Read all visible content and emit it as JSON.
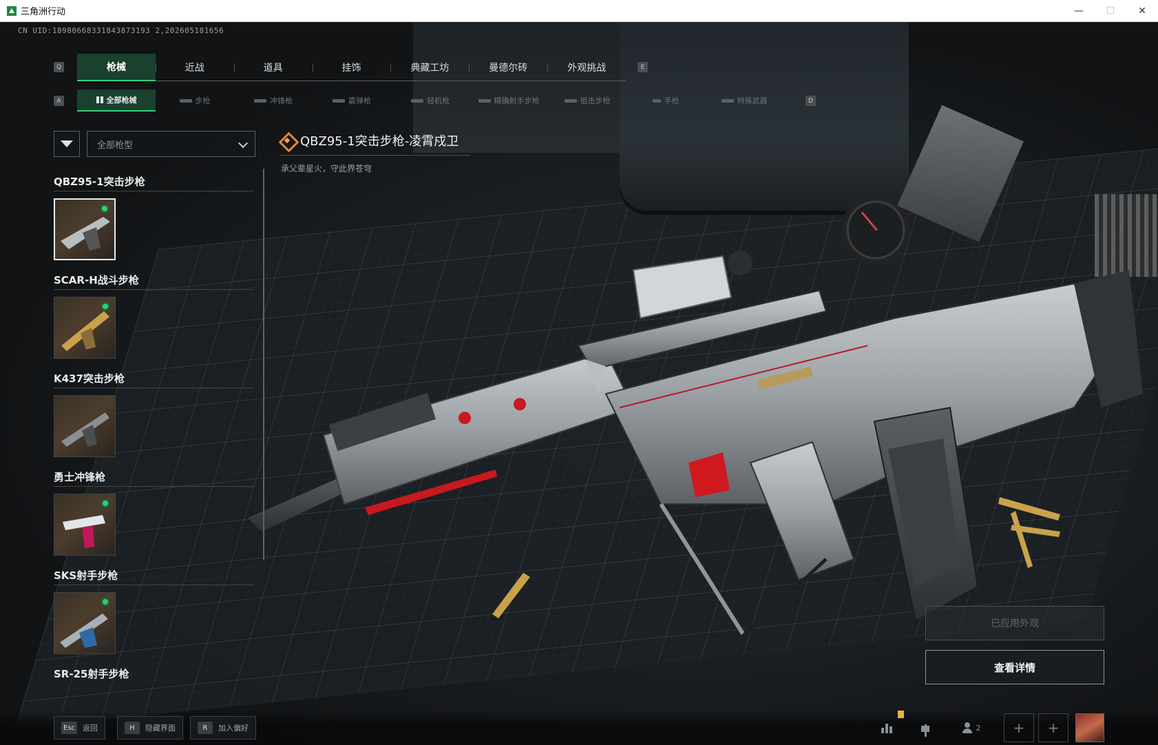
{
  "window": {
    "title": "三角洲行动",
    "minimize": "—",
    "maximize": "☐",
    "close": "✕"
  },
  "uid_line": "CN UID:18980668331843873193 2,202605181656",
  "tabs": {
    "left_key": "Q",
    "right_key": "E",
    "items": [
      {
        "label": "枪械",
        "active": true
      },
      {
        "label": "近战"
      },
      {
        "label": "道具"
      },
      {
        "label": "挂饰"
      },
      {
        "label": "典藏工坊"
      },
      {
        "label": "曼德尔砖"
      },
      {
        "label": "外观挑战"
      }
    ]
  },
  "subtabs": {
    "left_key": "A",
    "right_key": "D",
    "items": [
      {
        "label": "全部枪械",
        "active": true
      },
      {
        "label": "步枪"
      },
      {
        "label": "冲锋枪"
      },
      {
        "label": "霰弹枪"
      },
      {
        "label": "轻机枪"
      },
      {
        "label": "精确射手步枪"
      },
      {
        "label": "狙击步枪"
      },
      {
        "label": "手枪"
      },
      {
        "label": "特殊武器"
      }
    ]
  },
  "filter": {
    "icon": "filter-icon",
    "select_value": "全部枪型"
  },
  "weapon_groups": [
    {
      "name": "QBZ95-1突击步枪",
      "owned": true,
      "selected": true
    },
    {
      "name": "SCAR-H战斗步枪",
      "owned": true,
      "selected": false
    },
    {
      "name": "K437突击步枪",
      "owned": false,
      "selected": false
    },
    {
      "name": "勇士冲锋枪",
      "owned": true,
      "selected": false
    },
    {
      "name": "SKS射手步枪",
      "owned": true,
      "selected": false
    },
    {
      "name": "SR-25射手步枪",
      "owned": false,
      "selected": false
    }
  ],
  "selected_weapon": {
    "title": "QBZ95-1突击步枪-凌霄戍卫",
    "subtitle": "承父辈星火，守此界苍穹",
    "rarity_color": "#e08a3a"
  },
  "actions": {
    "applied_label": "已应用外观",
    "details_label": "查看详情"
  },
  "hints": [
    {
      "key": "Esc",
      "label": "返回"
    },
    {
      "key": "H",
      "label": "隐藏界面"
    },
    {
      "key": "R",
      "label": "加入偏好"
    }
  ],
  "bottom_right": {
    "stats_icon": "stats-icon",
    "flag_icon": "flag-icon",
    "party_count": "2",
    "plus": "+"
  },
  "colors": {
    "accent": "#33d07a",
    "owned_dot": "#2fcf74"
  }
}
